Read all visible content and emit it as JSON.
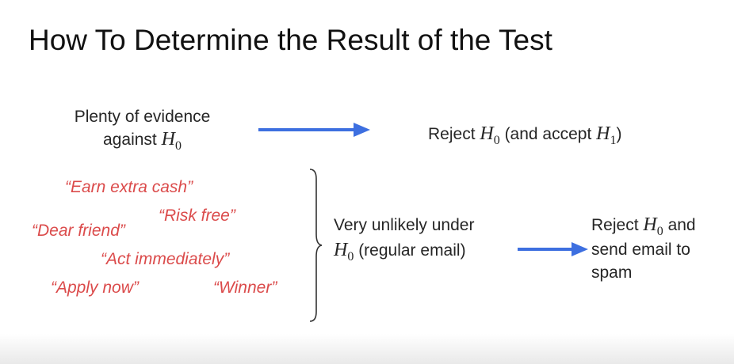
{
  "title": "How To Determine the Result of the Test",
  "top_row": {
    "evidence_line1": "Plenty of evidence",
    "evidence_line2_prefix": "against",
    "h0_symbol": "H",
    "h0_subscript": "0",
    "reject_prefix": "Reject",
    "reject_middle": "(and accept",
    "h1_symbol": "H",
    "h1_subscript": "1",
    "reject_suffix": ")"
  },
  "spam_phrases": [
    "“Earn extra cash”",
    "“Risk free”",
    "“Dear friend”",
    "“Act immediately”",
    "“Apply now”",
    "“Winner”"
  ],
  "bottom_row": {
    "unlikely_line1": "Very unlikely under",
    "h0_symbol": "H",
    "h0_subscript": "0",
    "unlikely_line2_suffix": "(regular email)",
    "reject_prefix": "Reject",
    "reject_line1_suffix": "and",
    "reject_line2": "send email to",
    "reject_line3": "spam"
  },
  "colors": {
    "arrow": "#3d6fe0",
    "spam_text": "#db4b4b",
    "text": "#262626"
  }
}
